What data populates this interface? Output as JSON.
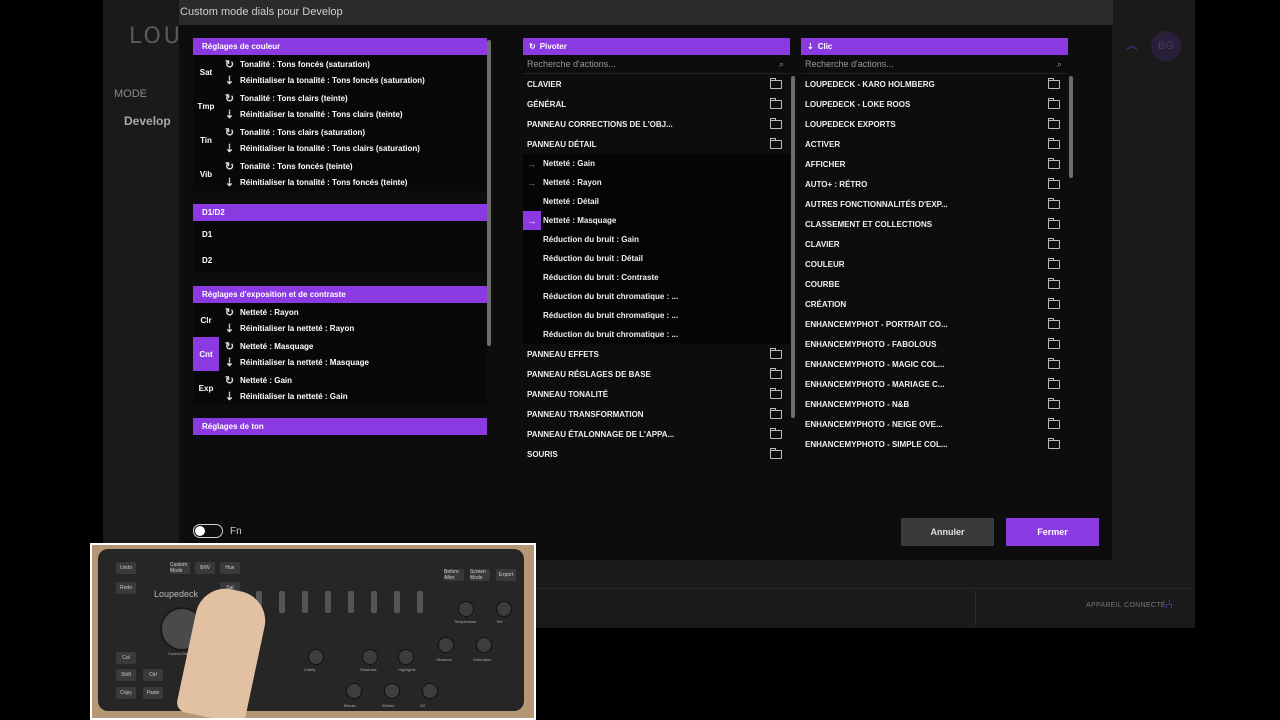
{
  "app": {
    "logo": "LOU",
    "mode_label": "MODE",
    "mode_value": "Develop",
    "avatar": "BG",
    "status": "APPAREIL CONNECTÉ"
  },
  "dialog": {
    "title": "Custom mode dials pour Develop",
    "left_panel": {
      "sections": [
        {
          "header": "Réglages de couleur",
          "rows": [
            {
              "abbr": "Sat",
              "rotate": "Tonalité : Tons foncés (saturation)",
              "click": "Réinitialiser la tonalité : Tons foncés (saturation)"
            },
            {
              "abbr": "Tmp",
              "rotate": "Tonalité : Tons clairs (teinte)",
              "click": "Réinitialiser la tonalité : Tons clairs (teinte)"
            },
            {
              "abbr": "Tin",
              "rotate": "Tonalité : Tons clairs (saturation)",
              "click": "Réinitialiser la tonalité : Tons clairs (saturation)"
            },
            {
              "abbr": "Vib",
              "rotate": "Tonalité : Tons foncés (teinte)",
              "click": "Réinitialiser la tonalité : Tons foncés (teinte)"
            }
          ]
        },
        {
          "header": "D1/D2",
          "dial_rows": [
            "D1",
            "D2"
          ]
        },
        {
          "header": "Réglages d'exposition et de contraste",
          "rows": [
            {
              "abbr": "Clr",
              "rotate": "Netteté : Rayon",
              "click": "Réinitialiser la netteté : Rayon"
            },
            {
              "abbr": "Cnt",
              "rotate": "Netteté : Masquage",
              "click": "Réinitialiser la netteté : Masquage",
              "selected": true
            },
            {
              "abbr": "Exp",
              "rotate": "Netteté : Gain",
              "click": "Réinitialiser la netteté : Gain"
            }
          ]
        },
        {
          "header": "Réglages de ton"
        }
      ]
    },
    "rotate_column": {
      "header": "Pivoter",
      "search_placeholder": "Recherche d'actions...",
      "items_top": [
        "CLAVIER",
        "GÉNÉRAL",
        "PANNEAU CORRECTIONS DE L'OBJ...",
        "PANNEAU DÉTAIL"
      ],
      "sub_items": [
        {
          "label": "Netteté : Gain",
          "arrow": "→"
        },
        {
          "label": "Netteté : Rayon",
          "arrow": "→"
        },
        {
          "label": "Netteté : Détail",
          "arrow": ""
        },
        {
          "label": "Netteté : Masquage",
          "arrow": "→",
          "active": true
        },
        {
          "label": "Réduction du bruit : Gain",
          "arrow": ""
        },
        {
          "label": "Réduction du bruit : Détail",
          "arrow": ""
        },
        {
          "label": "Réduction du bruit : Contraste",
          "arrow": ""
        },
        {
          "label": "Réduction du bruit chromatique : ...",
          "arrow": ""
        },
        {
          "label": "Réduction du bruit chromatique : ...",
          "arrow": ""
        },
        {
          "label": "Réduction du bruit chromatique : ...",
          "arrow": ""
        }
      ],
      "items_bottom": [
        "PANNEAU EFFETS",
        "PANNEAU RÉGLAGES DE BASE",
        "PANNEAU TONALITÉ",
        "PANNEAU TRANSFORMATION",
        "PANNEAU ÉTALONNAGE DE L'APPA...",
        "SOURIS"
      ]
    },
    "click_column": {
      "header": "Clic",
      "search_placeholder": "Recherche d'actions...",
      "items": [
        "LOUPEDECK - KARO HOLMBERG",
        "LOUPEDECK - LOKE ROOS",
        "LOUPEDECK EXPORTS",
        "ACTIVER",
        "AFFICHER",
        "AUTO+ : RÉTRO",
        "AUTRES FONCTIONNALITÉS D'EXP...",
        "CLASSEMENT ET COLLECTIONS",
        "CLAVIER",
        "COULEUR",
        "COURBE",
        "CRÉATION",
        "ENHANCEMYPHOT - PORTRAIT CO...",
        "ENHANCEMYPHOTO - FABOLOUS",
        "ENHANCEMYPHOTO - MAGIC COL...",
        "ENHANCEMYPHOTO - MARIAGE C...",
        "ENHANCEMYPHOTO - N&B",
        "ENHANCEMYPHOTO - NEIGE OVE...",
        "ENHANCEMYPHOTO - SIMPLE COL..."
      ]
    },
    "fn_label": "Fn",
    "cancel_label": "Annuler",
    "close_label": "Fermer"
  },
  "device": {
    "logo": "Loupedeck",
    "keys": [
      "Undo",
      "Redo",
      "Custom Mode",
      "B/W",
      "Hue",
      "Sat",
      "Lum",
      "Before After",
      "Screen Mode",
      "Export",
      "Col",
      "Shift",
      "Ctrl",
      "Copy",
      "Paste"
    ],
    "labels": [
      "Temperature",
      "Tint",
      "Clarity",
      "Shadows",
      "Highlights",
      "Vibrance",
      "Saturation",
      "Blacks",
      "Whites",
      "D2",
      "Control Dial"
    ]
  },
  "colors": {
    "accent": "#8a3ae0",
    "background": "#0d0d0d"
  }
}
